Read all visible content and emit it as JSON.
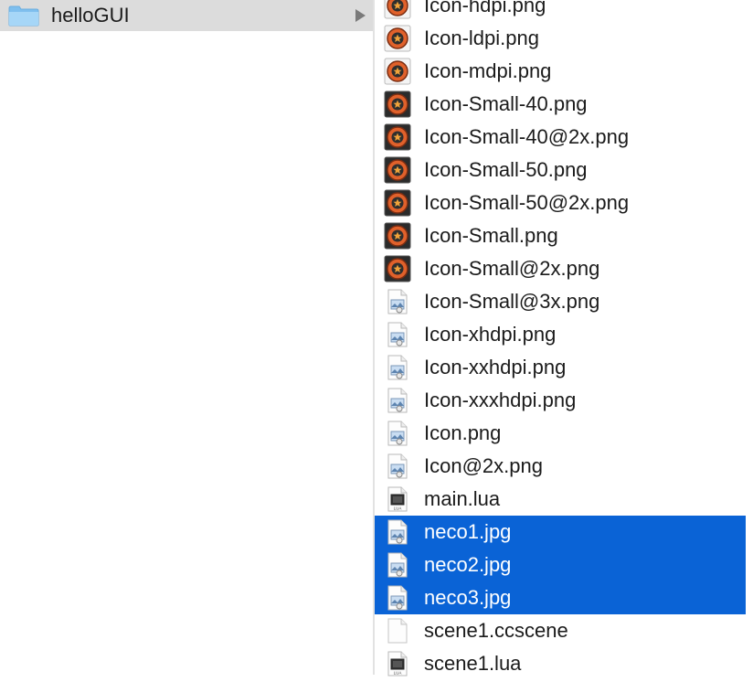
{
  "sidebar": {
    "folder_label": "helloGUI"
  },
  "files": [
    {
      "name": "Icon-hdpi.png",
      "icon": "app-icon",
      "selected": false
    },
    {
      "name": "Icon-ldpi.png",
      "icon": "app-icon",
      "selected": false
    },
    {
      "name": "Icon-mdpi.png",
      "icon": "app-icon",
      "selected": false
    },
    {
      "name": "Icon-Small-40.png",
      "icon": "app-icon-dark",
      "selected": false
    },
    {
      "name": "Icon-Small-40@2x.png",
      "icon": "app-icon-dark",
      "selected": false
    },
    {
      "name": "Icon-Small-50.png",
      "icon": "app-icon-dark",
      "selected": false
    },
    {
      "name": "Icon-Small-50@2x.png",
      "icon": "app-icon-dark",
      "selected": false
    },
    {
      "name": "Icon-Small.png",
      "icon": "app-icon-dark",
      "selected": false
    },
    {
      "name": "Icon-Small@2x.png",
      "icon": "app-icon-dark",
      "selected": false
    },
    {
      "name": "Icon-Small@3x.png",
      "icon": "image-file-icon",
      "selected": false
    },
    {
      "name": "Icon-xhdpi.png",
      "icon": "image-file-icon",
      "selected": false
    },
    {
      "name": "Icon-xxhdpi.png",
      "icon": "image-file-icon",
      "selected": false
    },
    {
      "name": "Icon-xxxhdpi.png",
      "icon": "image-file-icon",
      "selected": false
    },
    {
      "name": "Icon.png",
      "icon": "image-file-icon",
      "selected": false
    },
    {
      "name": "Icon@2x.png",
      "icon": "image-file-icon",
      "selected": false
    },
    {
      "name": "main.lua",
      "icon": "lua-file-icon",
      "selected": false
    },
    {
      "name": "neco1.jpg",
      "icon": "image-file-icon",
      "selected": true
    },
    {
      "name": "neco2.jpg",
      "icon": "image-file-icon",
      "selected": true
    },
    {
      "name": "neco3.jpg",
      "icon": "image-file-icon",
      "selected": true
    },
    {
      "name": "scene1.ccscene",
      "icon": "blank-file-icon",
      "selected": false
    },
    {
      "name": "scene1.lua",
      "icon": "lua-file-icon",
      "selected": false
    }
  ],
  "colors": {
    "selection": "#0a63d6",
    "folder_row": "#dcdcdc",
    "folder_icon": "#8fc8f2"
  }
}
